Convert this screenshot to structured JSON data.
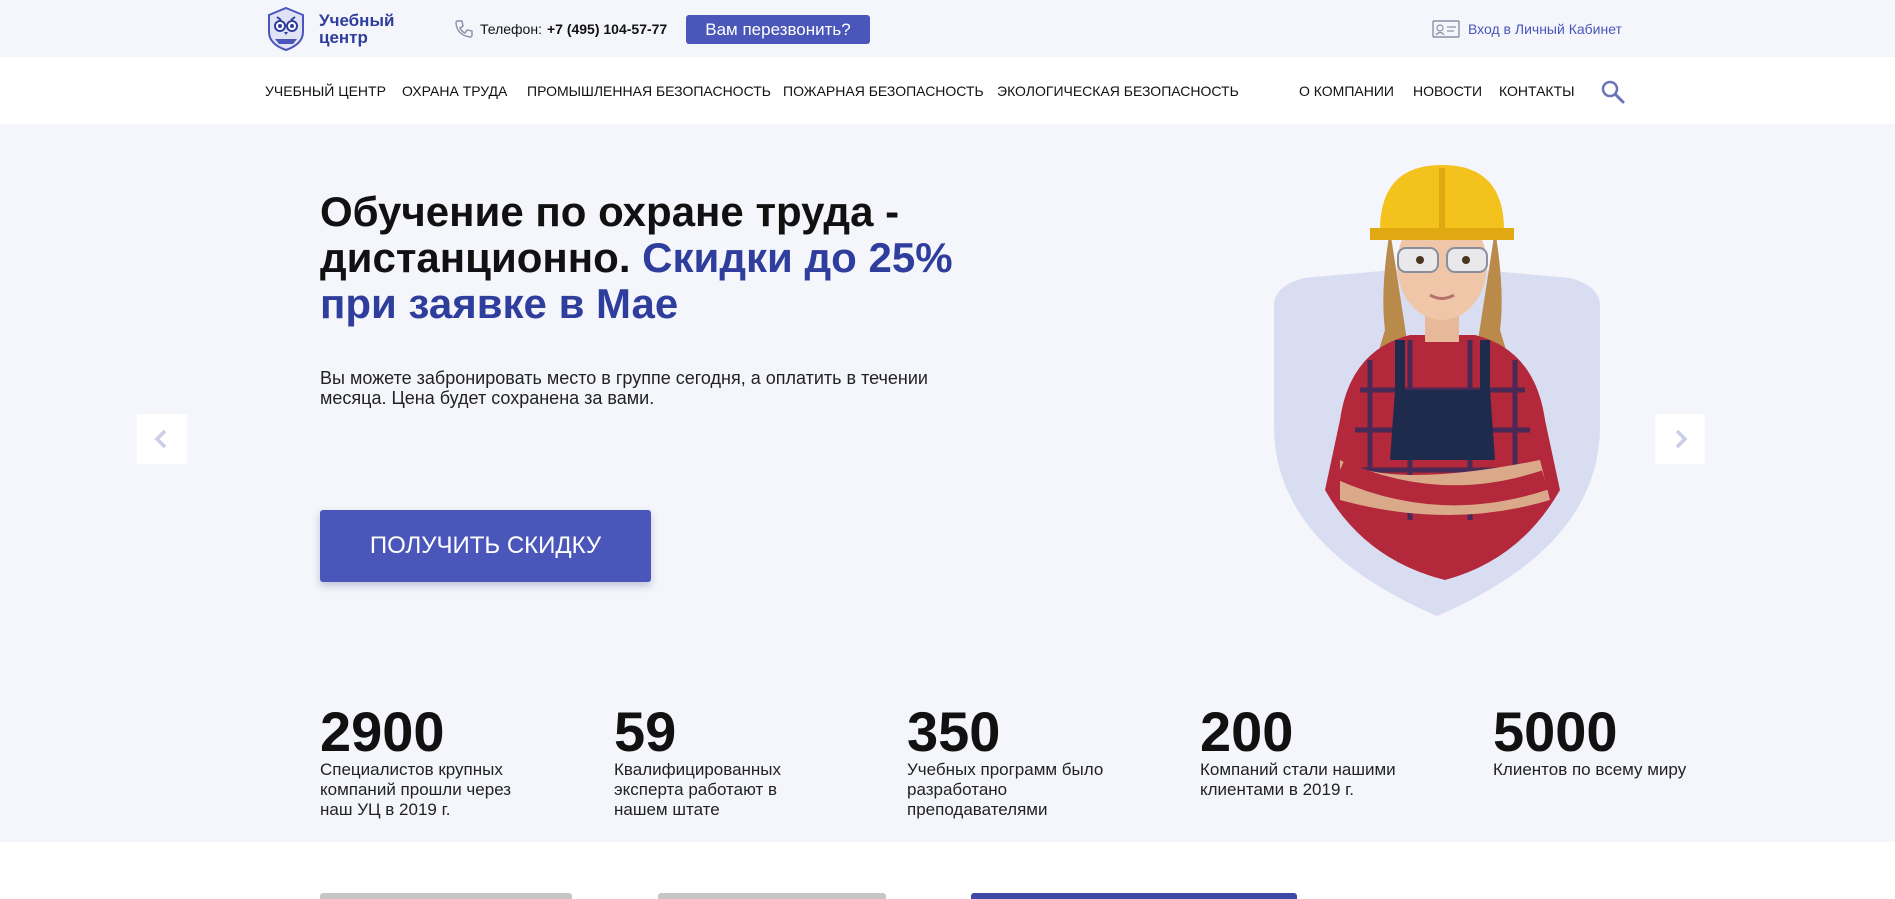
{
  "header": {
    "logo_text": "Учебный центр",
    "phone_label": "Телефон:",
    "phone_number": "+7 (495) 104-57-77",
    "callback_label": "Вам перезвонить?",
    "cabinet_label": "Вход в Личный Кабинет"
  },
  "nav": {
    "items": [
      "УЧЕБНЫЙ ЦЕНТР",
      "ОХРАНА ТРУДА",
      "ПРОМЫШЛЕННАЯ БЕЗОПАСНОСТЬ",
      "ПОЖАРНАЯ БЕЗОПАСНОСТЬ",
      "ЭКОЛОГИЧЕСКАЯ БЕЗОПАСНОСТЬ",
      "О КОМПАНИИ",
      "НОВОСТИ",
      "КОНТАКТЫ"
    ],
    "search_icon": "search-icon"
  },
  "hero": {
    "title_part1": "Обучение по охране труда - дистанционно.",
    "title_accent": "Скидки до 25% при заявке в Мае",
    "subtitle": "Вы можете забронировать место в группе сегодня, а оплатить в течении месяца. Цена будет сохранена за вами.",
    "cta_label": "ПОЛУЧИТЬ СКИДКУ",
    "prev_icon": "chevron-left-icon",
    "next_icon": "chevron-right-icon"
  },
  "stats": [
    {
      "number": "2900",
      "desc": "Специалистов крупных компаний прошли через наш УЦ в 2019 г."
    },
    {
      "number": "59",
      "desc": "Квалифицированных эксперта работают в нашем штате"
    },
    {
      "number": "350",
      "desc": "Учебных программ было разработано преподавателями"
    },
    {
      "number": "200",
      "desc": "Компаний стали нашими клиентами в 2019 г."
    },
    {
      "number": "5000",
      "desc": "Клиентов по всему миру"
    }
  ],
  "colors": {
    "brand": "#4a56b9",
    "accent_text": "#2f3d9c",
    "background": "#f4f6fb"
  }
}
